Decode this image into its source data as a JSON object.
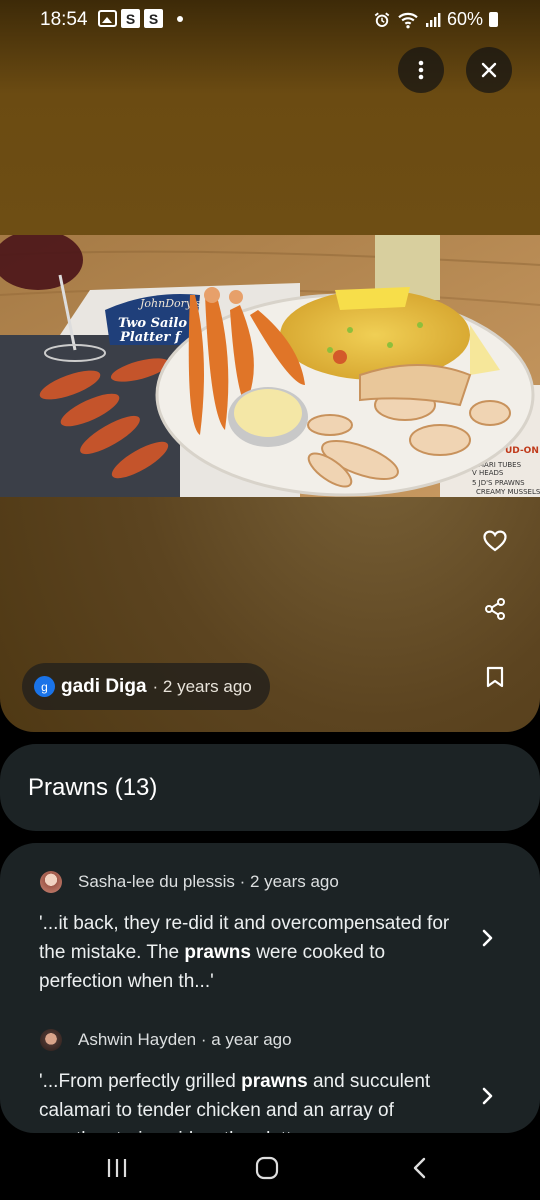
{
  "status_bar": {
    "time": "18:54",
    "badges": [
      "S",
      "S"
    ],
    "battery": "60%",
    "icons": [
      "gallery-icon",
      "alarm-icon",
      "wifi-icon",
      "signal-icon",
      "battery-icon"
    ]
  },
  "photo_view": {
    "author": {
      "avatar_letter": "g",
      "name": "gadi Diga",
      "time": "· 2 years ago"
    },
    "photo_text": {
      "brand": "JohnDory's",
      "platter_line1": "Two Sailo",
      "platter_line2": "Platter f",
      "side_menu": [
        "UD-ON",
        "MARI TUBES",
        "V HEADS",
        "5 JD'S PRAWNS",
        "CREAMY MUSSELS"
      ]
    },
    "actions": [
      "more-vert-icon",
      "close-icon",
      "heart-icon",
      "share-icon",
      "bookmark-icon"
    ]
  },
  "section": {
    "title": "Prawns (13)"
  },
  "reviews": [
    {
      "author": "Sasha-lee du plessis · 2 years ago",
      "text_before": "'...it back, they re-did  it and overcompensated for the mistake. The ",
      "highlight": "prawns",
      "text_after": " were cooked to perfection when th...'"
    },
    {
      "author": "Ashwin Hayden · a year ago",
      "text_before": "'...From perfectly grilled ",
      "highlight": "prawns",
      "text_after": " and succulent calamari to tender chicken and an array of mouthwatering sides, the platter was..."
    }
  ],
  "colors": {
    "panel": "#1c2325",
    "photo_bg": "#6b4b12",
    "accent_blue": "#1a73e8"
  }
}
